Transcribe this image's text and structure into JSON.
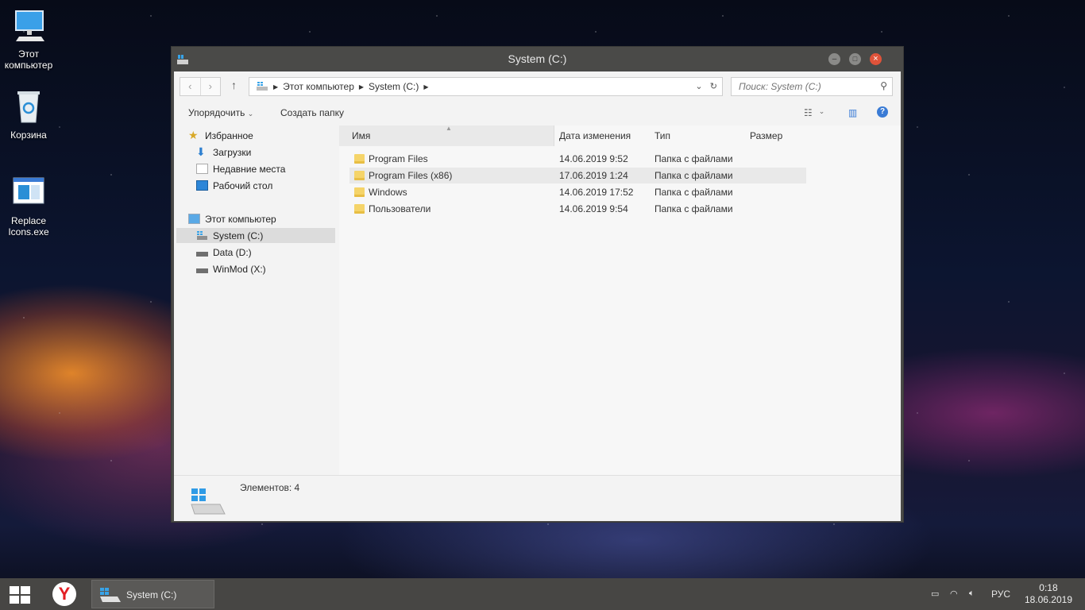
{
  "desktop": {
    "icons": [
      {
        "label": "Этот\nкомпьютер",
        "icon": "computer-icon"
      },
      {
        "label": "Корзина",
        "icon": "recycle-bin-icon"
      },
      {
        "label": "Replace\nIcons.exe",
        "icon": "exe-icon"
      }
    ]
  },
  "window": {
    "title": "System (C:)",
    "address": {
      "segments": [
        "Этот компьютер",
        "System (C:)"
      ]
    },
    "search": {
      "placeholder": "Поиск: System (C:)"
    },
    "toolbar": {
      "organize": "Упорядочить",
      "new_folder": "Создать папку"
    },
    "nav": {
      "favorites": "Избранное",
      "downloads": "Загрузки",
      "recent": "Недавние места",
      "desktop": "Рабочий стол",
      "this_pc": "Этот компьютер",
      "drive_c": "System (C:)",
      "drive_d": "Data (D:)",
      "drive_x": "WinMod (X:)"
    },
    "columns": {
      "name": "Имя",
      "date": "Дата изменения",
      "type": "Тип",
      "size": "Размер"
    },
    "files": [
      {
        "name": "Program Files",
        "date": "14.06.2019 9:52",
        "type": "Папка с файлами"
      },
      {
        "name": "Program Files (x86)",
        "date": "17.06.2019 1:24",
        "type": "Папка с файлами"
      },
      {
        "name": "Windows",
        "date": "14.06.2019 17:52",
        "type": "Папка с файлами"
      },
      {
        "name": "Пользователи",
        "date": "14.06.2019 9:54",
        "type": "Папка с файлами"
      }
    ],
    "details": {
      "count": "Элементов: 4"
    }
  },
  "taskbar": {
    "task_label": "System (C:)",
    "language": "РУС",
    "time": "0:18",
    "date": "18.06.2019"
  },
  "colors": {
    "close": "#e0533a",
    "folder": "#f5d469",
    "accent": "#3a7bd5"
  }
}
